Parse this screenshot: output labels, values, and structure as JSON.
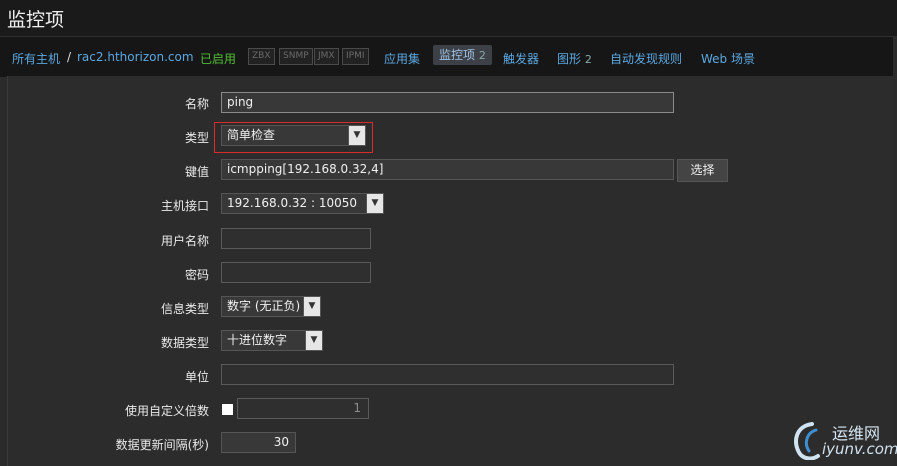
{
  "page": {
    "title": "监控项"
  },
  "nav": {
    "all_hosts": "所有主机",
    "separator": "/",
    "host": "rac2.hthorizon.com",
    "status": "已启用",
    "badges": [
      "ZBX",
      "SNMP",
      "JMX",
      "IPMI"
    ],
    "applications": "应用集",
    "items": "监控项",
    "items_count": "2",
    "triggers": "触发器",
    "graphs": "图形",
    "graphs_count": "2",
    "discovery": "自动发现规则",
    "web": "Web 场景"
  },
  "form": {
    "name_label": "名称",
    "name_value": "ping",
    "type_label": "类型",
    "type_value": "简单检查",
    "key_label": "键值",
    "key_value": "icmpping[192.168.0.32,4]",
    "select_button": "选择",
    "interface_label": "主机接口",
    "interface_value": "192.168.0.32 : 10050",
    "username_label": "用户名称",
    "username_value": "",
    "password_label": "密码",
    "password_value": "",
    "info_type_label": "信息类型",
    "info_type_value": "数字 (无正负)",
    "data_type_label": "数据类型",
    "data_type_value": "十进位数字",
    "units_label": "单位",
    "units_value": "",
    "multiplier_label": "使用自定义倍数",
    "multiplier_value": "1",
    "interval_label": "数据更新间隔(秒)",
    "interval_value": "30"
  },
  "watermark": {
    "cn": "运维网",
    "en": "iyunv.com"
  },
  "colors": {
    "link": "#5ba8e0",
    "enabled": "#4fbd33",
    "highlight": "#d92d2d",
    "background": "#2b2b2b"
  }
}
